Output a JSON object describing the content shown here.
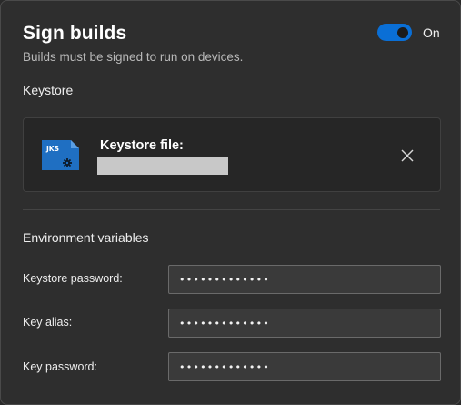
{
  "header": {
    "title": "Sign builds",
    "subtitle": "Builds must be signed to run on devices.",
    "toggle_state": "On"
  },
  "keystore": {
    "section_title": "Keystore",
    "file_label": "Keystore file:",
    "icon_text": "JKS",
    "icon_name": "jks-file-icon",
    "close_icon_name": "close-icon"
  },
  "environment": {
    "section_title": "Environment variables",
    "fields": [
      {
        "label": "Keystore password:",
        "value": "•••••••••••••"
      },
      {
        "label": "Key alias:",
        "value": "•••••••••••••"
      },
      {
        "label": "Key password:",
        "value": "•••••••••••••"
      }
    ]
  },
  "colors": {
    "accent": "#0a6fd6",
    "background": "#2e2e2e",
    "icon_blue": "#1f6fc2"
  }
}
